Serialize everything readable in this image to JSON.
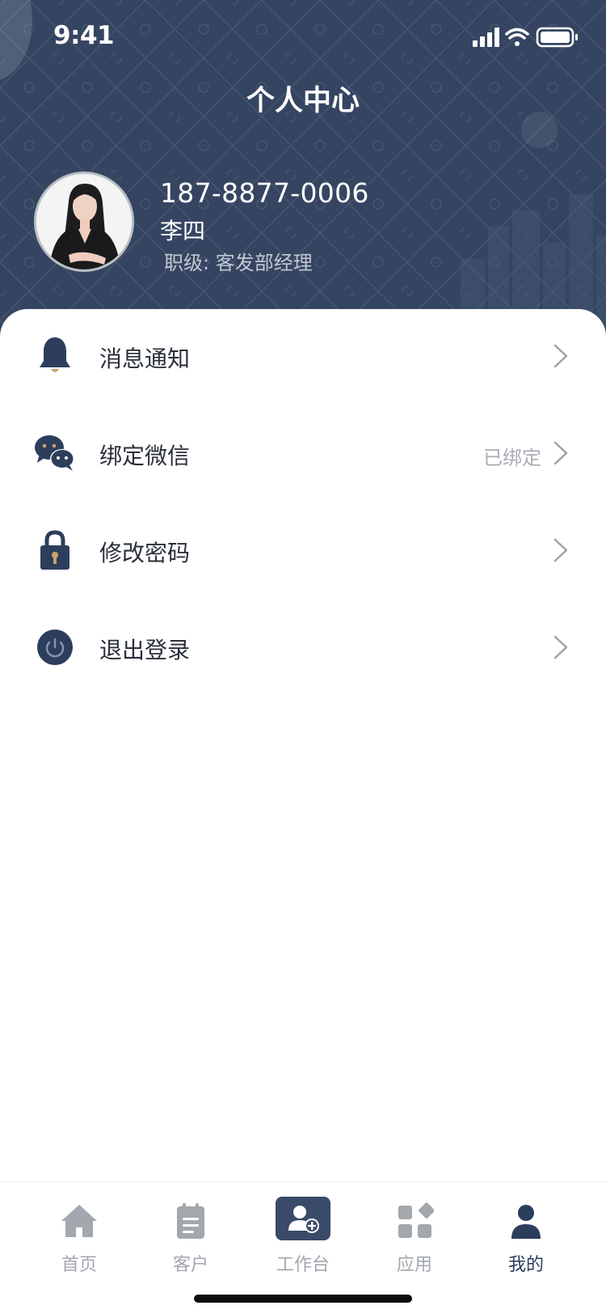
{
  "status_bar": {
    "time": "9:41"
  },
  "header": {
    "title": "个人中心",
    "background_color": "#354561"
  },
  "profile": {
    "phone": "187-8877-0006",
    "name": "李四",
    "job_label": "职级:",
    "job_title": "客发部经理"
  },
  "menu": {
    "items": [
      {
        "label": "消息通知",
        "value": "",
        "icon": "bell-icon"
      },
      {
        "label": "绑定微信",
        "value": "已绑定",
        "icon": "wechat-icon"
      },
      {
        "label": "修改密码",
        "value": "",
        "icon": "lock-icon"
      },
      {
        "label": "退出登录",
        "value": "",
        "icon": "power-icon"
      }
    ]
  },
  "tabbar": {
    "tabs": [
      {
        "label": "首页",
        "icon": "home-icon",
        "active": false
      },
      {
        "label": "客户",
        "icon": "clipboard-icon",
        "active": false
      },
      {
        "label": "工作台",
        "icon": "user-add-icon",
        "active": false
      },
      {
        "label": "应用",
        "icon": "apps-grid-icon",
        "active": false
      },
      {
        "label": "我的",
        "icon": "person-icon",
        "active": true
      }
    ]
  },
  "colors": {
    "accent": "#2d3e5c",
    "icon_gold": "#caa56a",
    "inactive_tab": "#a3a7ae"
  }
}
